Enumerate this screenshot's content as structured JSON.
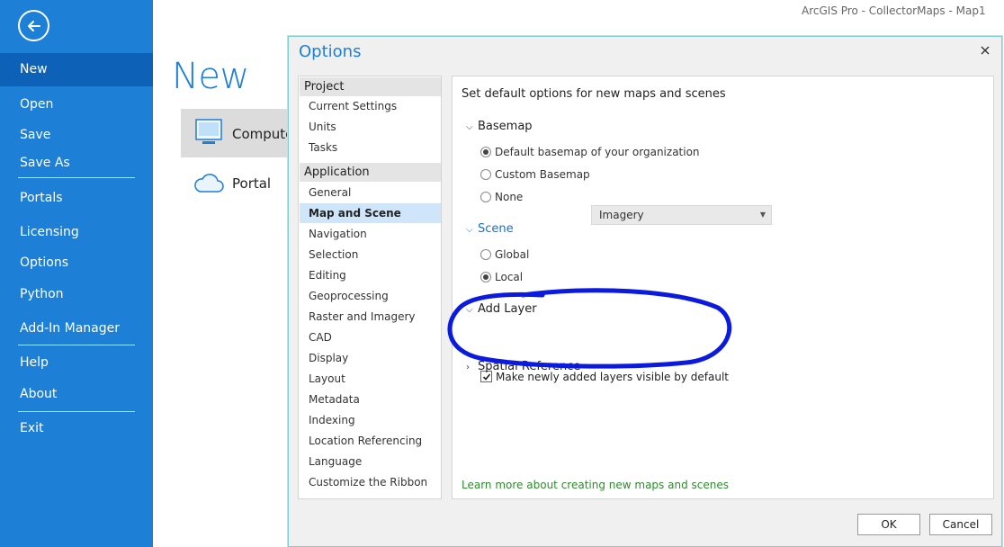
{
  "app_title": "ArcGIS Pro - CollectorMaps - Map1",
  "backstage": {
    "items": [
      {
        "label": "New"
      },
      {
        "label": "Open"
      },
      {
        "label": "Save"
      },
      {
        "label": "Save As"
      },
      {
        "label": "Portals"
      },
      {
        "label": "Licensing"
      },
      {
        "label": "Options"
      },
      {
        "label": "Python"
      },
      {
        "label": "Add-In Manager"
      },
      {
        "label": "Help"
      },
      {
        "label": "About"
      },
      {
        "label": "Exit"
      }
    ],
    "active": "New"
  },
  "main": {
    "title": "New",
    "locations": [
      {
        "label": "Computer",
        "icon": "computer-icon"
      },
      {
        "label": "Portal",
        "icon": "cloud-icon"
      }
    ]
  },
  "dialog": {
    "title": "Options",
    "nav": {
      "groups": [
        {
          "header": "Project",
          "items": [
            "Current Settings",
            "Units",
            "Tasks"
          ]
        },
        {
          "header": "Application",
          "items": [
            "General",
            "Map and Scene",
            "Navigation",
            "Selection",
            "Editing",
            "Geoprocessing",
            "Raster and Imagery",
            "CAD",
            "Display",
            "Layout",
            "Metadata",
            "Indexing",
            "Location Referencing",
            "Language",
            "Customize the Ribbon"
          ]
        }
      ],
      "selected": "Map and Scene"
    },
    "content": {
      "title": "Set default options for new maps and scenes",
      "basemap": {
        "label": "Basemap",
        "options": [
          "Default basemap of your organization",
          "Custom Basemap",
          "None"
        ],
        "selected": "Default basemap of your organization",
        "custom_value": "Imagery"
      },
      "scene": {
        "label": "Scene",
        "options": [
          "Global",
          "Local"
        ],
        "selected": "Local"
      },
      "add_layer": {
        "label": "Add Layer",
        "checkbox_label": "Make newly added layers visible by default",
        "checked": true
      },
      "spatial_reference": {
        "label": "Spatial Reference"
      },
      "learn_more": "Learn more about creating new maps and scenes"
    },
    "buttons": {
      "ok": "OK",
      "cancel": "Cancel"
    }
  },
  "colors": {
    "backstage_bg": "#1d7fd6",
    "backstage_active": "#0d62b8",
    "accent": "#1d7fd6",
    "nav_selected": "#cfe5fa",
    "link": "#2f8a2f",
    "annotation": "#0a1adf"
  }
}
